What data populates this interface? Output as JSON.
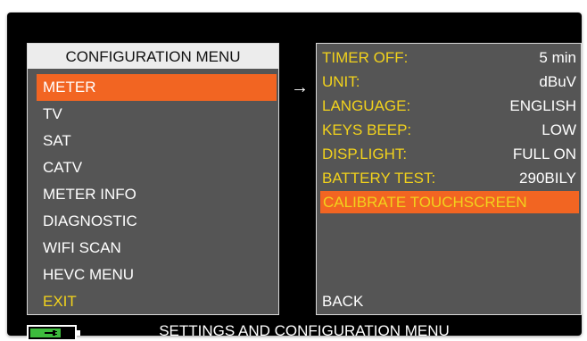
{
  "config_menu": {
    "title": "CONFIGURATION MENU",
    "items": [
      {
        "label": "METER",
        "selected": true
      },
      {
        "label": "TV"
      },
      {
        "label": "SAT"
      },
      {
        "label": "CATV"
      },
      {
        "label": "METER INFO"
      },
      {
        "label": "DIAGNOSTIC"
      },
      {
        "label": "WIFI SCAN"
      },
      {
        "label": "HEVC MENU"
      },
      {
        "label": "EXIT"
      }
    ]
  },
  "settings": {
    "rows": [
      {
        "label": "TIMER OFF:",
        "value": "5 min"
      },
      {
        "label": "UNIT:",
        "value": "dBuV"
      },
      {
        "label": "LANGUAGE:",
        "value": "ENGLISH"
      },
      {
        "label": "KEYS BEEP:",
        "value": "LOW"
      },
      {
        "label": "DISP.LIGHT:",
        "value": "FULL ON"
      },
      {
        "label": "BATTERY TEST:",
        "value": "290BILY"
      }
    ],
    "calibrate_label": "CALIBRATE TOUCHSCREEN",
    "back_label": "BACK"
  },
  "status_bar": {
    "text": "SETTINGS AND CONFIGURATION MENU",
    "battery_level": 0.7
  },
  "colors": {
    "highlight": "#f26522",
    "label_yellow": "#f2d21c",
    "panel_gray": "#555555",
    "battery_green": "#3dbb3d"
  }
}
